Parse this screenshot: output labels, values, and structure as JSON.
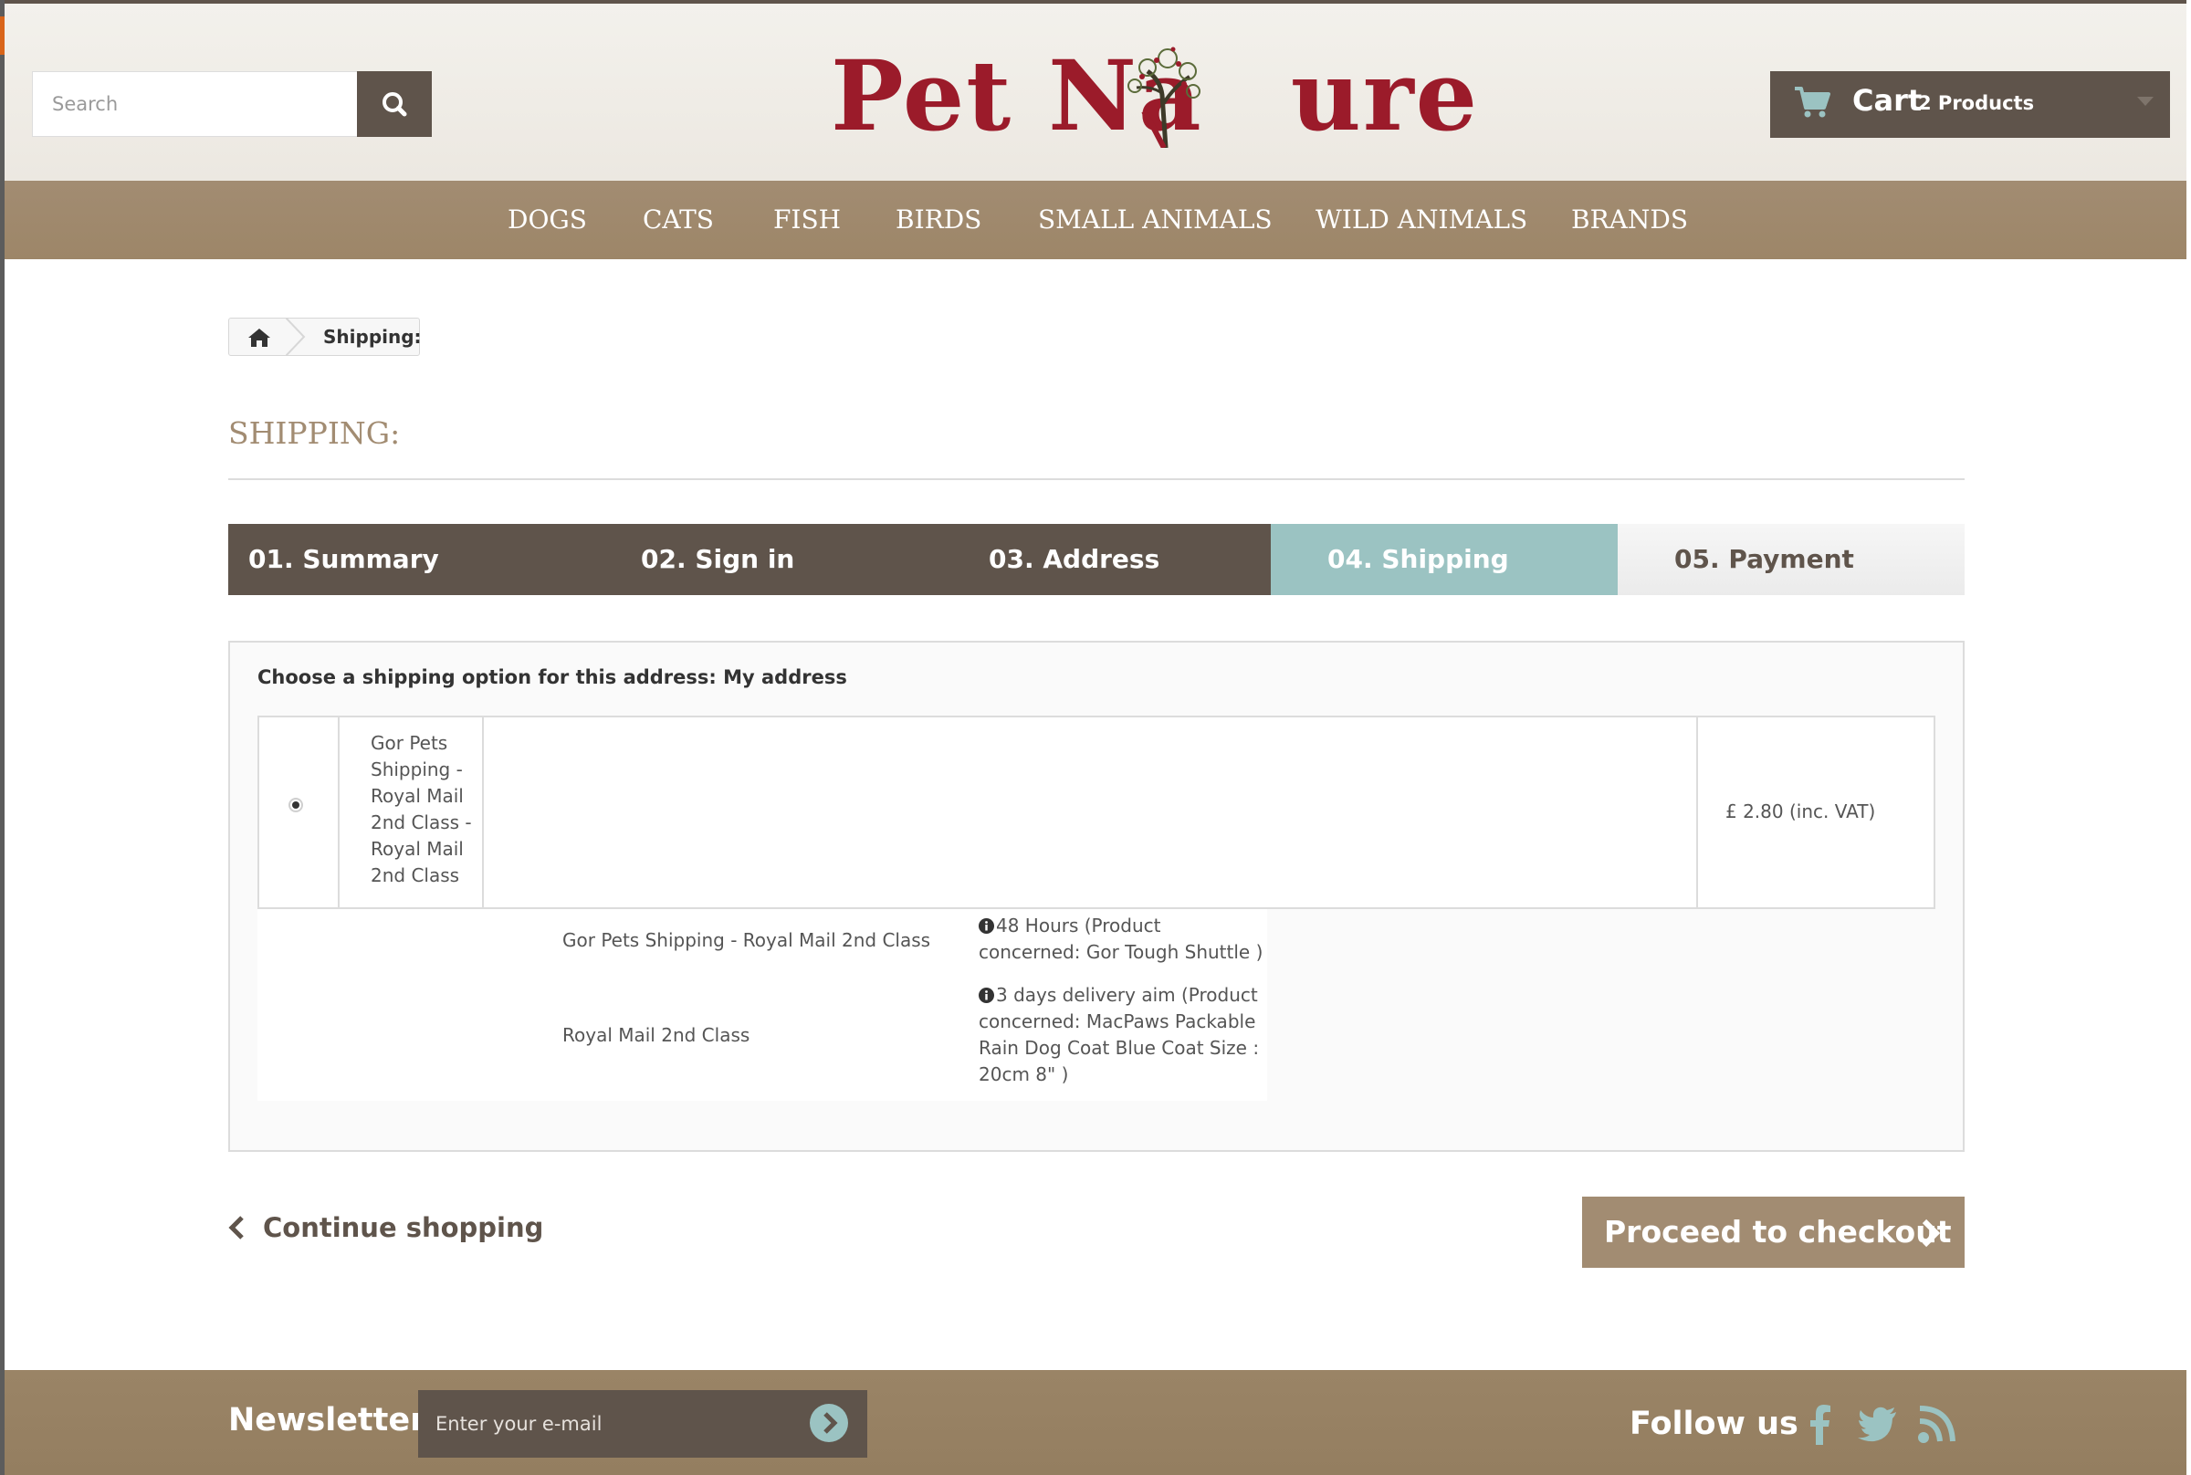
{
  "header": {
    "search_placeholder": "Search",
    "logo_text_left": "Pet Na",
    "logo_text_right": "ure",
    "cart_label": "Cart",
    "cart_count": "2 Products"
  },
  "nav": {
    "items": [
      "DOGS",
      "CATS",
      "FISH",
      "BIRDS",
      "SMALL ANIMALS",
      "WILD ANIMALS",
      "BRANDS"
    ]
  },
  "breadcrumb": {
    "current": "Shipping:"
  },
  "page": {
    "title": "SHIPPING:"
  },
  "steps": [
    {
      "label": "01. Summary",
      "state": "done"
    },
    {
      "label": "02. Sign in",
      "state": "done"
    },
    {
      "label": "03. Address",
      "state": "done"
    },
    {
      "label": "04. Shipping",
      "state": "current"
    },
    {
      "label": "05. Payment",
      "state": "todo"
    }
  ],
  "shipping": {
    "heading": "Choose a shipping option for this address: My address",
    "option": {
      "name": "Gor Pets Shipping - Royal Mail 2nd Class - Royal Mail 2nd Class",
      "price": "£ 2.80 (inc. VAT)",
      "selected": true
    },
    "details": [
      {
        "carrier": "Gor Pets Shipping - Royal Mail 2nd Class",
        "info": "48 Hours (Product concerned: Gor Tough Shuttle )"
      },
      {
        "carrier": "Royal Mail 2nd Class",
        "info": "3 days delivery aim (Product concerned: MacPaws Packable Rain Dog Coat Blue Coat Size : 20cm 8\" )"
      }
    ]
  },
  "actions": {
    "continue_label": "Continue shopping",
    "checkout_label": "Proceed to checkout"
  },
  "footer": {
    "newsletter_label": "Newsletter",
    "newsletter_placeholder": "Enter your e-mail",
    "follow_label": "Follow us",
    "social_icons": [
      "facebook-icon",
      "twitter-icon",
      "rss-icon"
    ]
  },
  "colors": {
    "brand_brown": "#5f544b",
    "nav_tan": "#a28c72",
    "step_current": "#9bc3c2",
    "logo_red": "#9b1b2a"
  }
}
